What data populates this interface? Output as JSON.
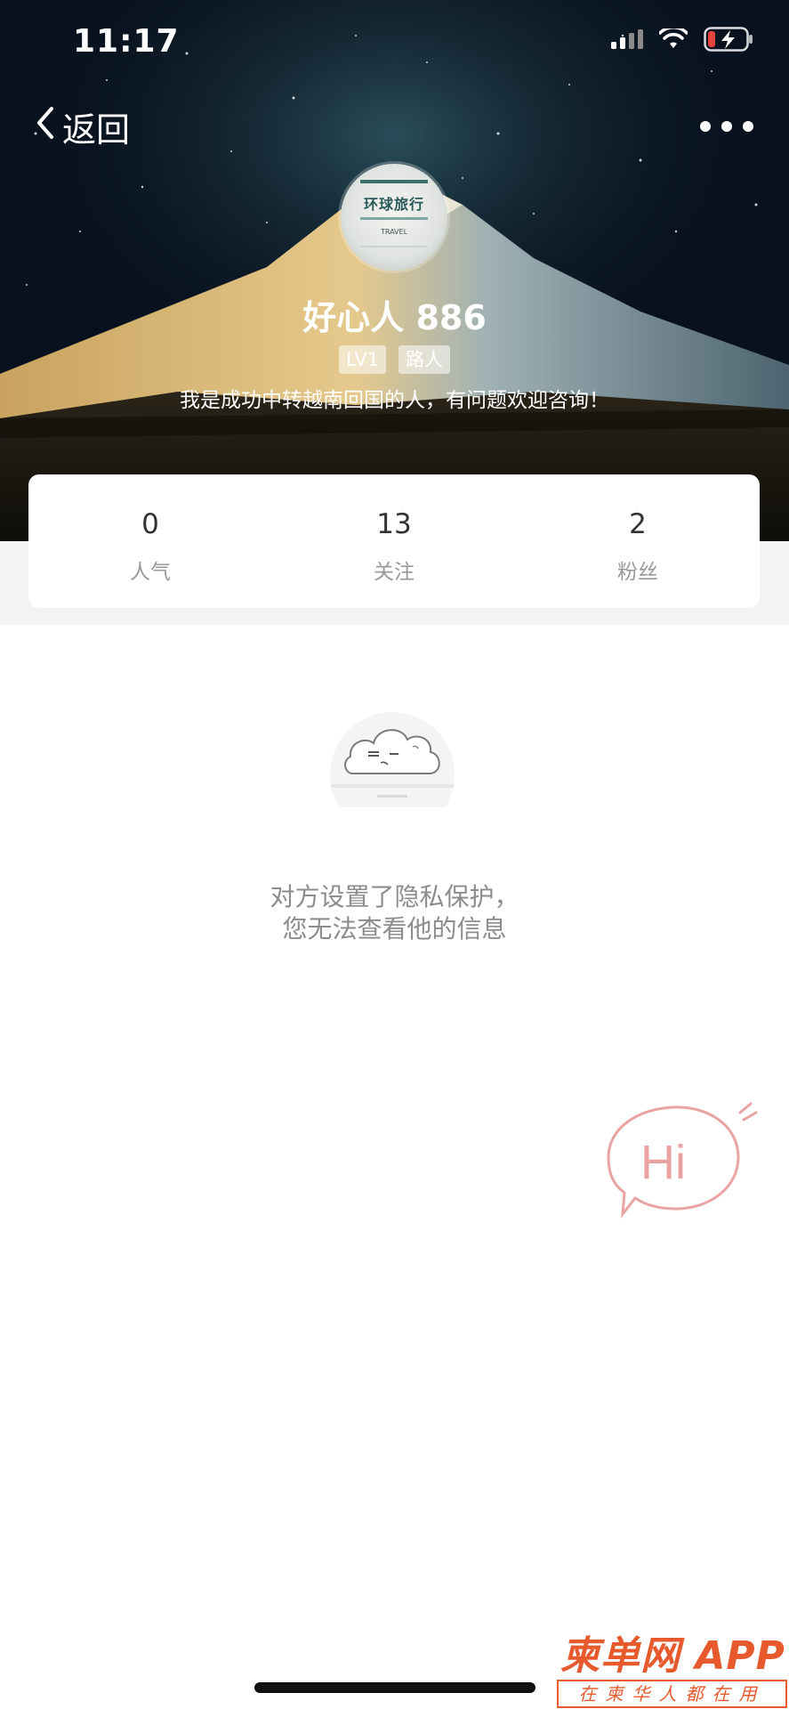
{
  "status_bar": {
    "time": "11:17"
  },
  "nav": {
    "back_label": "返回"
  },
  "profile": {
    "avatar_title": "环球旅行",
    "avatar_tag": "TRAVEL",
    "username": "好心人 886",
    "badges": [
      "LV1",
      "路人"
    ],
    "bio": "我是成功中转越南回国的人，有问题欢迎咨询！"
  },
  "stats": [
    {
      "value": "0",
      "label": "人气"
    },
    {
      "value": "13",
      "label": "关注"
    },
    {
      "value": "2",
      "label": "粉丝"
    }
  ],
  "privacy": {
    "line1": "对方设置了隐私保护，",
    "line2": "您无法查看他的信息"
  },
  "hi_button": {
    "label": "Hi",
    "color": "#e9a3a3"
  },
  "watermark": {
    "title": "柬单网 APP",
    "subtitle": "在柬华人都在用",
    "color": "#e65a2e"
  },
  "icons": [
    "signal-icon",
    "wifi-icon",
    "battery-charging-icon",
    "back-chevron-icon",
    "more-icon",
    "cloud-mascot-icon",
    "hi-bubble-icon"
  ]
}
